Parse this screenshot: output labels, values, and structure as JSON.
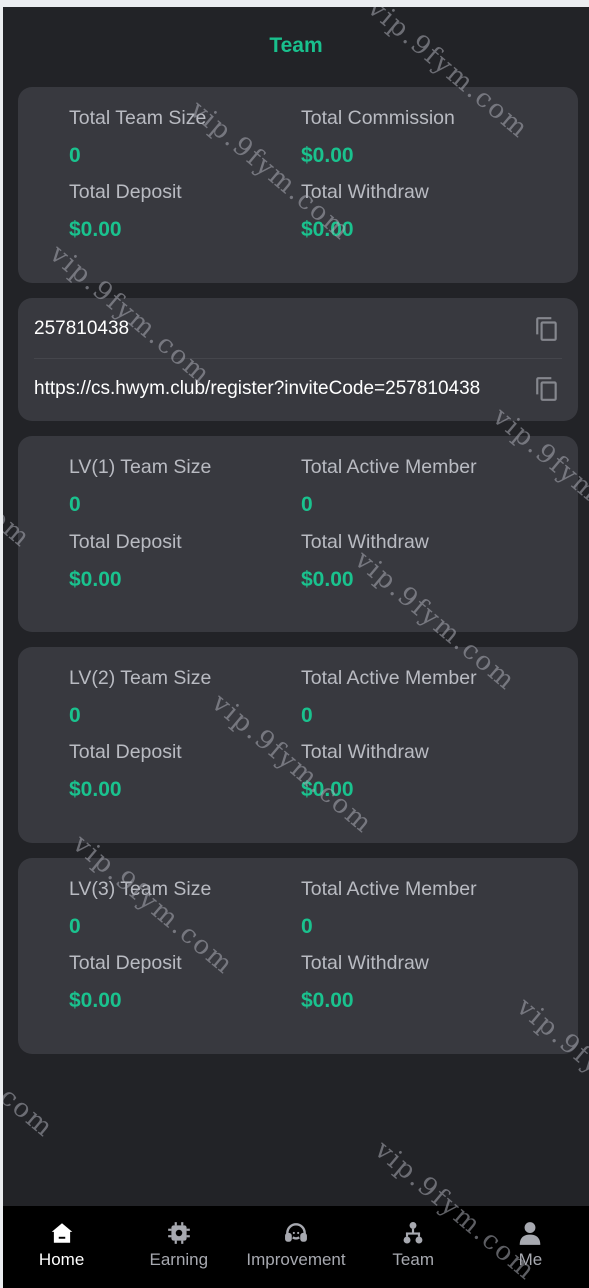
{
  "header": {
    "title": "Team"
  },
  "summary": {
    "team_size_label": "Total Team Size",
    "team_size_value": "0",
    "commission_label": "Total Commission",
    "commission_value": "$0.00",
    "deposit_label": "Total Deposit",
    "deposit_value": "$0.00",
    "withdraw_label": "Total Withdraw",
    "withdraw_value": "$0.00"
  },
  "invite": {
    "code": "257810438",
    "link": "https://cs.hwym.club/register?inviteCode=257810438",
    "copy_icon": "copy-icon"
  },
  "levels": [
    {
      "size_label": "LV(1) Team Size",
      "size_value": "0",
      "active_label": "Total Active Member",
      "active_value": "0",
      "deposit_label": "Total Deposit",
      "deposit_value": "$0.00",
      "withdraw_label": "Total Withdraw",
      "withdraw_value": "$0.00"
    },
    {
      "size_label": "LV(2) Team Size",
      "size_value": "0",
      "active_label": "Total Active Member",
      "active_value": "0",
      "deposit_label": "Total Deposit",
      "deposit_value": "$0.00",
      "withdraw_label": "Total Withdraw",
      "withdraw_value": "$0.00"
    },
    {
      "size_label": "LV(3) Team Size",
      "size_value": "0",
      "active_label": "Total Active Member",
      "active_value": "0",
      "deposit_label": "Total Deposit",
      "deposit_value": "$0.00",
      "withdraw_label": "Total Withdraw",
      "withdraw_value": "$0.00"
    }
  ],
  "tabbar": {
    "items": [
      {
        "label": "Home",
        "icon": "home-icon",
        "active": true
      },
      {
        "label": "Earning",
        "icon": "chip-icon",
        "active": false
      },
      {
        "label": "Improvement",
        "icon": "headset-icon",
        "active": false
      },
      {
        "label": "Team",
        "icon": "team-icon",
        "active": false
      },
      {
        "label": "Me",
        "icon": "person-icon",
        "active": false
      }
    ]
  },
  "watermark": {
    "text": "vip.9fym.com"
  },
  "colors": {
    "accent": "#1ac28e",
    "background": "#222327",
    "card": "#38393f",
    "tabbar": "#000000"
  }
}
